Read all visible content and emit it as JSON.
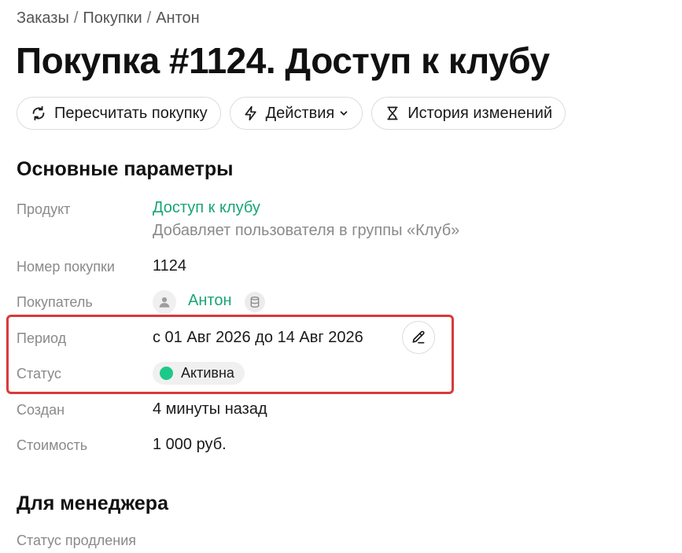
{
  "breadcrumb": {
    "items": [
      "Заказы",
      "Покупки",
      "Антон"
    ],
    "separator": "/"
  },
  "page_title": "Покупка #1124. Доступ к клубу",
  "toolbar": {
    "recalc_label": "Пересчитать покупку",
    "actions_label": "Действия",
    "history_label": "История изменений",
    "recalc_icon": "refresh-icon",
    "actions_icon": "lightning-icon",
    "history_icon": "hourglass-icon"
  },
  "main_section": {
    "title": "Основные параметры",
    "product": {
      "label": "Продукт",
      "name": "Доступ к клубу",
      "description": "Добавляет пользователя в группы «Клуб»"
    },
    "purchase_number": {
      "label": "Номер покупки",
      "value": "1124"
    },
    "buyer": {
      "label": "Покупатель",
      "name": "Антон"
    },
    "period": {
      "label": "Период",
      "value": "с 01 Авг 2026 до 14 Авг 2026"
    },
    "status": {
      "label": "Статус",
      "value": "Активна",
      "color": "#1dc98a"
    },
    "created": {
      "label": "Создан",
      "value": "4 минуты назад"
    },
    "cost": {
      "label": "Стоимость",
      "value": "1 000 руб."
    }
  },
  "manager_section": {
    "title": "Для менеджера",
    "renewal_status": {
      "label": "Статус продления"
    }
  },
  "colors": {
    "accent_green": "#17a673",
    "status_active": "#1dc98a",
    "highlight_red": "#d83a3a",
    "muted_text": "#8a8a8a"
  }
}
